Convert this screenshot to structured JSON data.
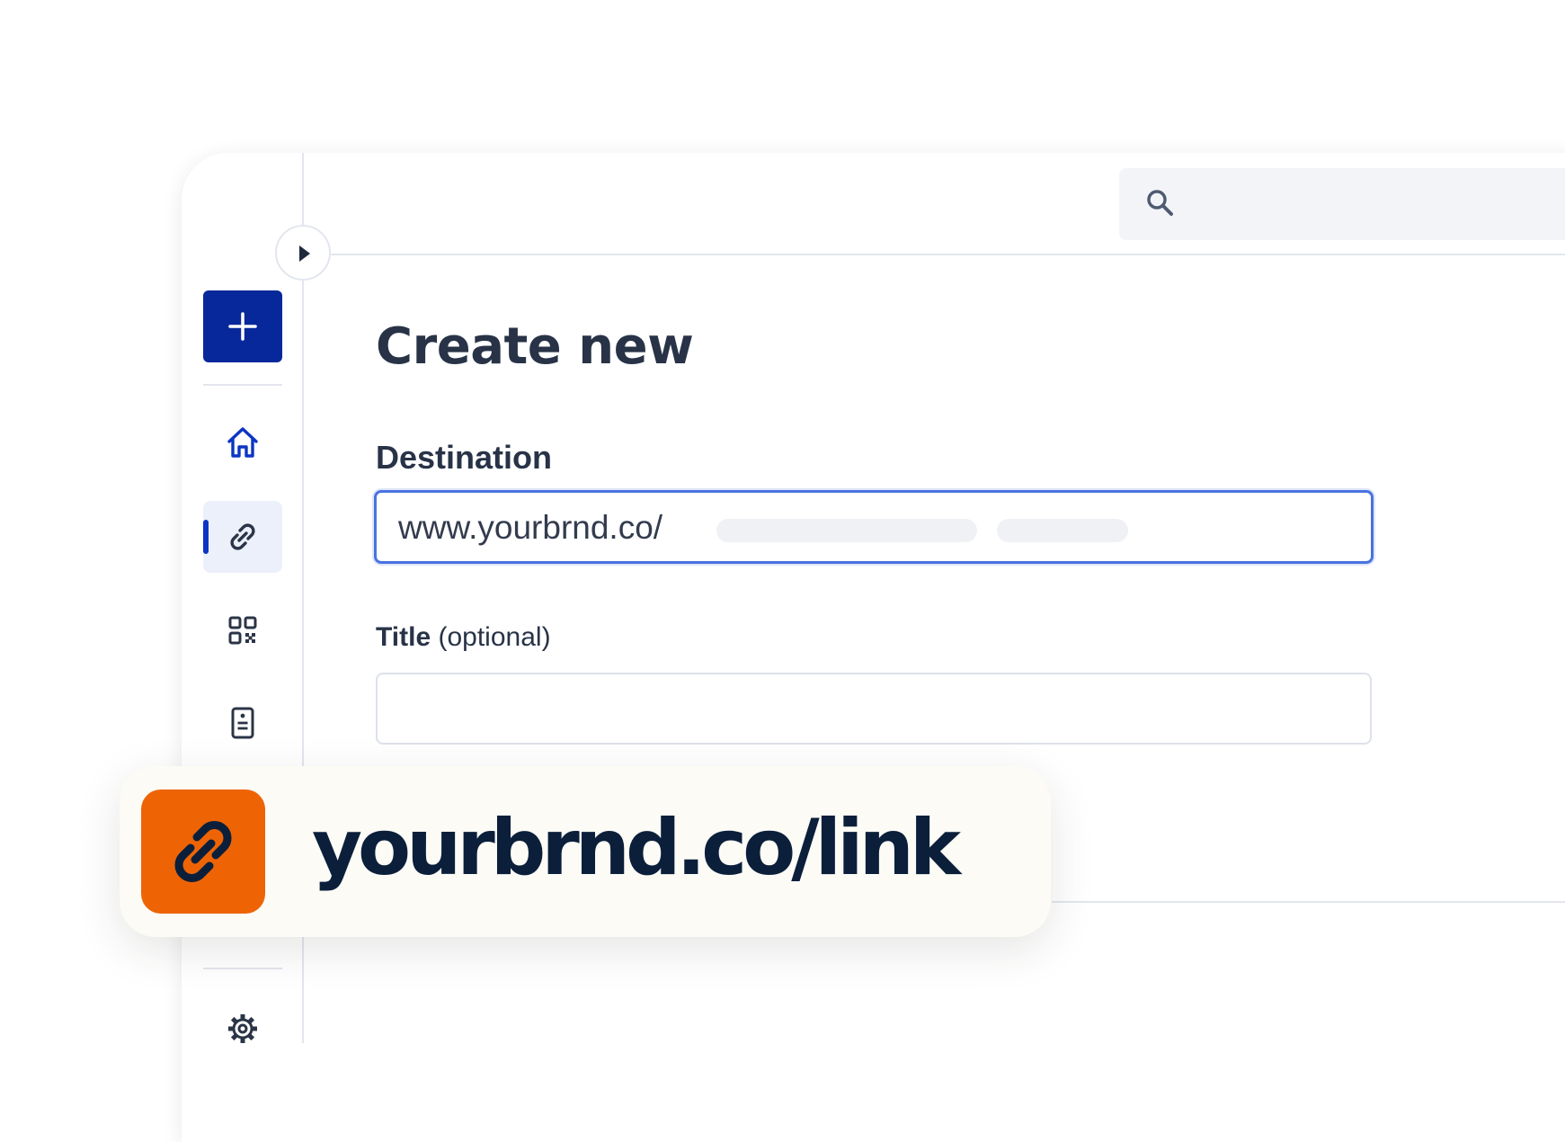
{
  "page": {
    "title": "Create new"
  },
  "form": {
    "destination_label": "Destination",
    "destination_value": "www.yourbrnd.co/",
    "title_label": "Title",
    "title_optional": "(optional)",
    "title_value": ""
  },
  "sidebar": {
    "items": [
      {
        "name": "create",
        "icon": "plus-icon"
      },
      {
        "name": "home",
        "icon": "home-icon"
      },
      {
        "name": "links",
        "icon": "link-icon",
        "active": true
      },
      {
        "name": "qr-codes",
        "icon": "qr-code-icon"
      },
      {
        "name": "pages",
        "icon": "document-icon"
      },
      {
        "name": "settings",
        "icon": "gear-icon"
      }
    ]
  },
  "highlight": {
    "link_text": "yourbrnd.co/link",
    "icon": "link-icon"
  },
  "colors": {
    "brand_primary": "#07289a",
    "accent_orange": "#ee6405",
    "text_dark": "#283347",
    "focus_blue": "#4a73e0"
  }
}
